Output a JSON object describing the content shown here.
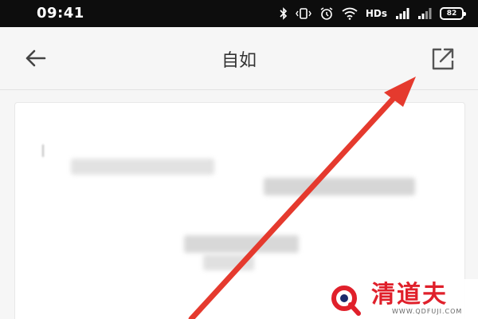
{
  "status_bar": {
    "time": "09:41",
    "network_label": "HDs",
    "battery_level": "82",
    "icons": [
      "bluetooth-icon",
      "vibrate-icon",
      "alarm-icon",
      "wifi-icon",
      "signal-icon",
      "signal-icon",
      "battery-icon"
    ]
  },
  "header": {
    "title": "自如",
    "back_icon": "arrow-left-icon",
    "share_icon": "share-external-icon"
  },
  "content": {
    "state": "blurred-placeholder"
  },
  "annotation": {
    "type": "arrow",
    "color": "#e53a2e",
    "points_to": "share-button"
  },
  "watermark": {
    "brand": "清道夫",
    "url": "WWW.QDFUJI.COM",
    "color": "#e0202b"
  }
}
